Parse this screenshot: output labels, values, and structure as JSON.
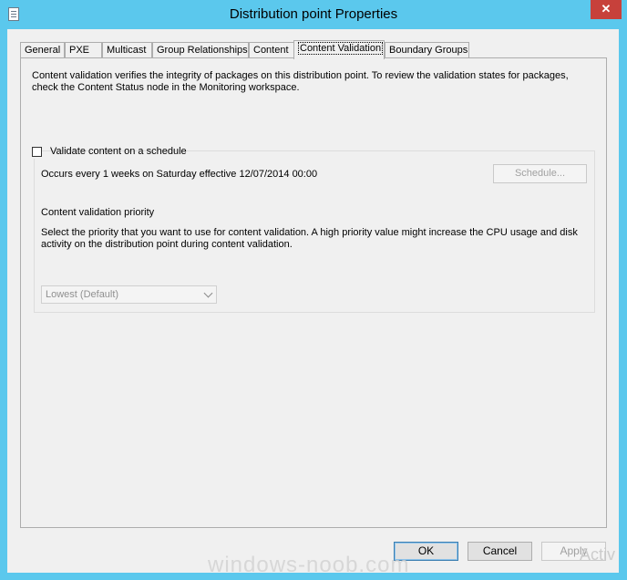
{
  "window": {
    "title": "Distribution point Properties",
    "close_glyph": "✕",
    "icon": "properties-page-icon"
  },
  "tabs": [
    {
      "label": "General"
    },
    {
      "label": "PXE"
    },
    {
      "label": "Multicast"
    },
    {
      "label": "Group Relationships"
    },
    {
      "label": "Content"
    },
    {
      "label": "Content Validation",
      "active": true
    },
    {
      "label": "Boundary Groups"
    }
  ],
  "panel": {
    "description": "Content validation verifies the integrity of packages on this distribution point. To review the validation states for packages, check the Content Status node in the Monitoring workspace.",
    "schedule_checkbox": {
      "label": "Validate content on a schedule",
      "checked": false
    },
    "occurs_text": "Occurs every 1 weeks on Saturday effective 12/07/2014 00:00",
    "schedule_button": "Schedule...",
    "priority_title": "Content validation priority",
    "priority_description": "Select the priority that you want to use for content validation. A high priority value might increase the CPU usage and disk activity on the distribution point during content validation.",
    "priority_select": {
      "value": "Lowest (Default)",
      "enabled": false
    }
  },
  "buttons": {
    "ok": "OK",
    "cancel": "Cancel",
    "apply": "Apply"
  },
  "overlay": {
    "watermark": "windows-noob.com",
    "activation": "Activ"
  },
  "colors": {
    "titlebar": "#5bc8ed",
    "close": "#c7413b",
    "dialog_bg": "#f0f0f0"
  }
}
